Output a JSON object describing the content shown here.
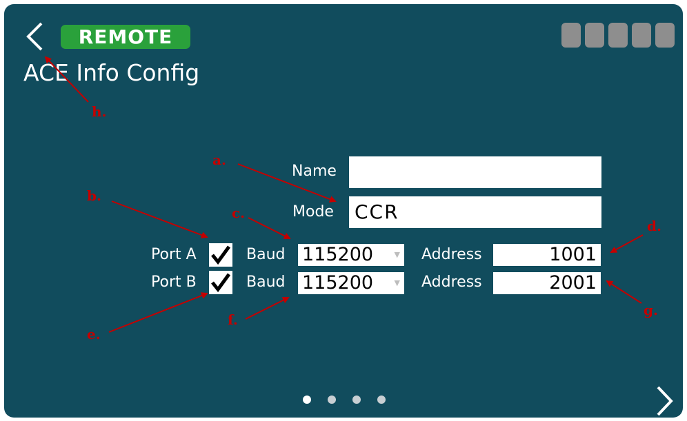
{
  "header": {
    "badge": "REMOTE",
    "title": "ACE Info Config"
  },
  "form": {
    "name_label": "Name",
    "name_value": "",
    "mode_label": "Mode",
    "mode_value": "CCR",
    "port_a": {
      "label": "Port A",
      "checked": true,
      "baud_label": "Baud",
      "baud_value": "115200",
      "address_label": "Address",
      "address_value": "1001"
    },
    "port_b": {
      "label": "Port B",
      "checked": true,
      "baud_label": "Baud",
      "baud_value": "115200",
      "address_label": "Address",
      "address_value": "2001"
    }
  },
  "pagination": {
    "current": 1,
    "total": 4
  },
  "annotations": {
    "a": "a.",
    "b": "b.",
    "c": "c.",
    "d": "d.",
    "e": "e.",
    "f": "f.",
    "g": "g.",
    "h": "h."
  },
  "colors": {
    "background": "#114c5d",
    "badge": "#2aa13b",
    "annotation": "#c40000",
    "status_square": "#8e8e8e"
  },
  "icons": {
    "back": "chevron-left-icon",
    "next": "chevron-right-icon",
    "check": "checkmark-icon"
  }
}
